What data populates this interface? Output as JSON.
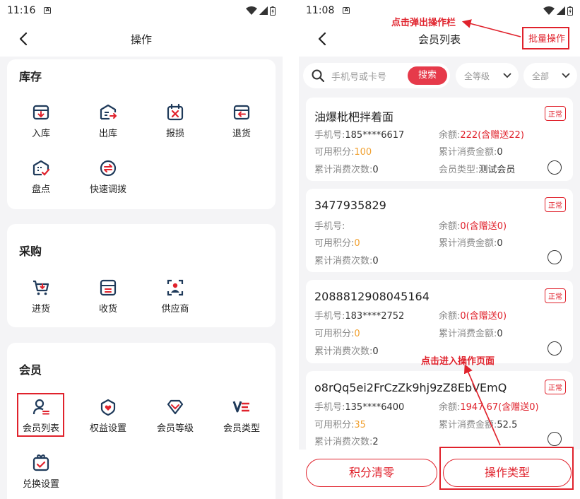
{
  "left": {
    "status_time": "11:16",
    "nav_title": "操作",
    "sections": [
      {
        "title": "库存",
        "items": [
          {
            "label": "入库",
            "icon": "inbound-box-icon"
          },
          {
            "label": "出库",
            "icon": "outbound-box-icon"
          },
          {
            "label": "报损",
            "icon": "damage-calendar-icon"
          },
          {
            "label": "退货",
            "icon": "return-icon"
          },
          {
            "label": "盘点",
            "icon": "stocktake-icon"
          },
          {
            "label": "快速调拨",
            "icon": "transfer-icon"
          }
        ]
      },
      {
        "title": "采购",
        "items": [
          {
            "label": "进货",
            "icon": "cart-icon"
          },
          {
            "label": "收货",
            "icon": "receive-icon"
          },
          {
            "label": "供应商",
            "icon": "supplier-icon"
          }
        ]
      },
      {
        "title": "会员",
        "items": [
          {
            "label": "会员列表",
            "icon": "member-list-icon"
          },
          {
            "label": "权益设置",
            "icon": "benefits-icon"
          },
          {
            "label": "会员等级",
            "icon": "diamond-icon"
          },
          {
            "label": "会员类型",
            "icon": "member-type-icon"
          },
          {
            "label": "兑换设置",
            "icon": "gift-icon"
          }
        ]
      }
    ]
  },
  "right": {
    "status_time": "11:08",
    "nav_title": "会员列表",
    "batch_button": "批量操作",
    "search_placeholder": "手机号或卡号",
    "search_button": "搜索",
    "filter_level": "全等级",
    "filter_all": "全部",
    "labels": {
      "phone": "手机号:",
      "balance": "余额:",
      "points": "可用积分:",
      "total_amount": "累计消费金额:",
      "total_count": "累计消费次数:",
      "member_type": "会员类型:"
    },
    "members": [
      {
        "name": "油爆枇杷拌着面",
        "status": "正常",
        "phone": "185****6617",
        "balance": "222(含赠送22)",
        "points": "100",
        "total_amount": "0",
        "total_count": "0",
        "member_type": "测试会员"
      },
      {
        "name": "3477935829",
        "status": "正常",
        "phone": "",
        "balance": "0(含赠送0)",
        "points": "0",
        "total_amount": "0",
        "total_count": "0"
      },
      {
        "name": "2088812908045164",
        "status": "正常",
        "phone": "183****2752",
        "balance": "0(含赠送0)",
        "points": "0",
        "total_amount": "0",
        "total_count": "0"
      },
      {
        "name": "o8rQq5ei2FrCzZk9hj9zZ8EbVEmQ",
        "status": "正常",
        "phone": "135****6400",
        "balance": "1947.67(含赠送0)",
        "points": "35",
        "total_amount": "52.5",
        "total_count": "2"
      }
    ],
    "clear_points_button": "积分清零",
    "operation_type_button": "操作类型"
  },
  "annotations": {
    "batch_hint": "点击弹出操作栏",
    "enter_hint": "点击进入操作页面"
  },
  "colors": {
    "accent": "#e0222c",
    "icon_navy": "#1f3a5a",
    "orange": "#f0a030"
  }
}
